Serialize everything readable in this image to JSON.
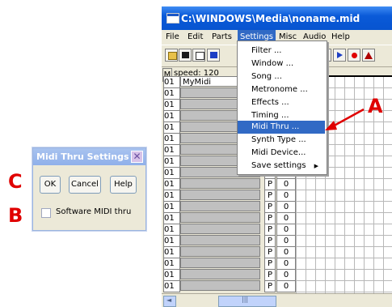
{
  "window": {
    "title": "C:\\WINDOWS\\Media\\noname.mid",
    "menu": [
      "File",
      "Edit",
      "Parts",
      "Settings",
      "Misc",
      "Audio",
      "Help"
    ],
    "active_menu_index": 3,
    "info": {
      "m_label": "M",
      "speed": "speed: 120"
    }
  },
  "toolbar_icons": [
    "open-folder-icon",
    "save-disk-icon",
    "new-file-icon",
    "notes-icon",
    "play-icon",
    "step-icon",
    "record-icon",
    "metronome-icon"
  ],
  "tracks": [
    {
      "num": "01",
      "name": "MyMidi",
      "p": "",
      "v": ""
    },
    {
      "num": "01",
      "name": "",
      "p": "",
      "v": ""
    },
    {
      "num": "01",
      "name": "",
      "p": "",
      "v": ""
    },
    {
      "num": "01",
      "name": "",
      "p": "",
      "v": ""
    },
    {
      "num": "01",
      "name": "",
      "p": "",
      "v": ""
    },
    {
      "num": "01",
      "name": "",
      "p": "",
      "v": ""
    },
    {
      "num": "01",
      "name": "",
      "p": "",
      "v": ""
    },
    {
      "num": "01",
      "name": "",
      "p": "",
      "v": ""
    },
    {
      "num": "01",
      "name": "",
      "p": "P",
      "v": "0"
    },
    {
      "num": "01",
      "name": "",
      "p": "P",
      "v": "0"
    },
    {
      "num": "01",
      "name": "",
      "p": "P",
      "v": "0"
    },
    {
      "num": "01",
      "name": "",
      "p": "P",
      "v": "0"
    },
    {
      "num": "01",
      "name": "",
      "p": "P",
      "v": "0"
    },
    {
      "num": "01",
      "name": "",
      "p": "P",
      "v": "0"
    },
    {
      "num": "01",
      "name": "",
      "p": "P",
      "v": "0"
    },
    {
      "num": "01",
      "name": "",
      "p": "P",
      "v": "0"
    },
    {
      "num": "01",
      "name": "",
      "p": "P",
      "v": "0"
    },
    {
      "num": "01",
      "name": "",
      "p": "P",
      "v": "0"
    },
    {
      "num": "01",
      "name": "",
      "p": "P",
      "v": "0"
    }
  ],
  "settings_menu": {
    "items": [
      {
        "label": "Filter ...",
        "submenu": false
      },
      {
        "label": "Window ...",
        "submenu": false
      },
      {
        "label": "Song ...",
        "submenu": false
      },
      {
        "label": "Metronome ...",
        "submenu": false
      },
      {
        "label": "Effects ...",
        "submenu": false
      },
      {
        "label": "Timing ...",
        "submenu": false
      },
      {
        "label": "Midi Thru ...",
        "submenu": false
      },
      {
        "label": "Synth Type ...",
        "submenu": false
      },
      {
        "label": "Midi Device...",
        "submenu": false
      },
      {
        "label": "Save settings",
        "submenu": true
      }
    ],
    "selected_index": 6
  },
  "annotations": {
    "a": "A",
    "b": "B",
    "c": "C"
  },
  "dialog": {
    "title": "Midi Thru Settings",
    "close": "✕",
    "ok": "OK",
    "cancel": "Cancel",
    "help": "Help",
    "checkbox_label": "Software MIDI thru",
    "checkbox_checked": false
  },
  "colors": {
    "annotation": "#e00000",
    "selection": "#316ac5",
    "titlebar": "#0a5ad8"
  }
}
